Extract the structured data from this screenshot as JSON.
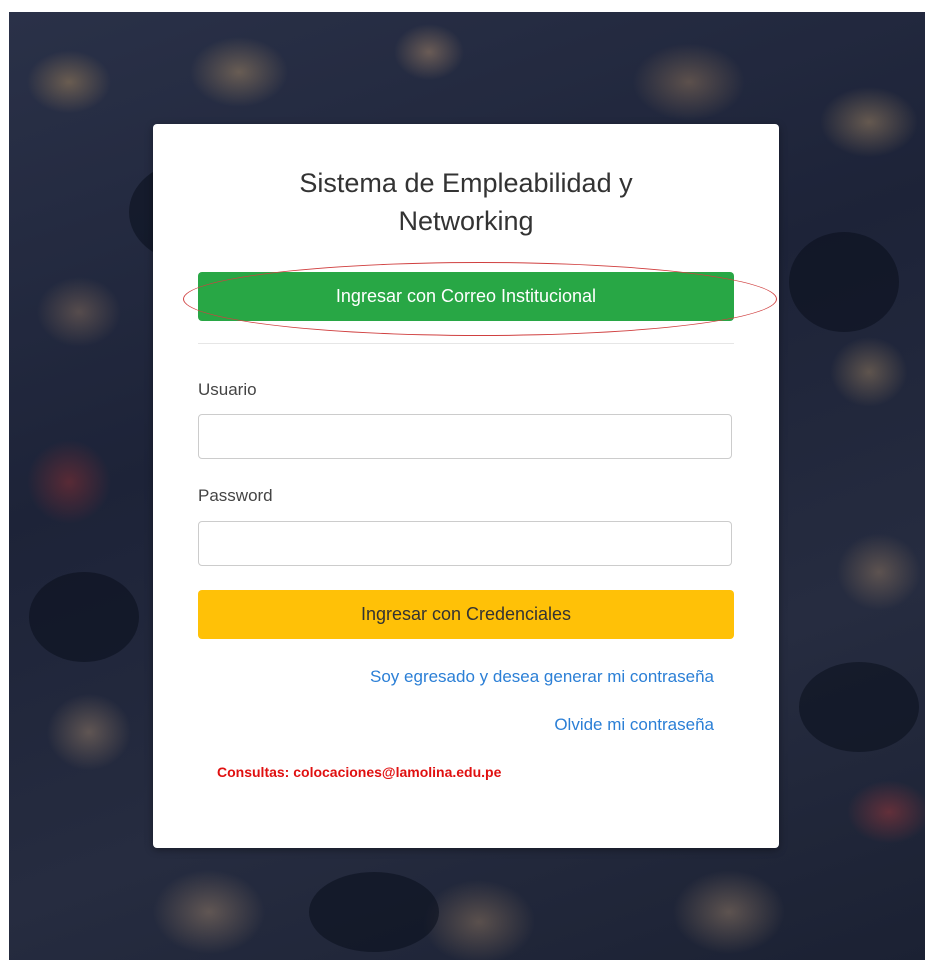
{
  "login": {
    "title_line1": "Sistema de Empleabilidad y",
    "title_line2": "Networking",
    "institutional_button": "Ingresar con Correo Institucional",
    "username_label": "Usuario",
    "username_value": "",
    "password_label": "Password",
    "password_value": "",
    "credentials_button": "Ingresar con Credenciales",
    "graduate_link": "Soy egresado y desea generar mi contraseña",
    "forgot_link": "Olvide mi contraseña",
    "contact_text": "Consultas: colocaciones@lamolina.edu.pe"
  },
  "colors": {
    "primary_green": "#28a745",
    "warning_yellow": "#ffc107",
    "link_blue": "#2b7fd6",
    "contact_red": "#e01010",
    "annotation_red": "#d04040"
  }
}
